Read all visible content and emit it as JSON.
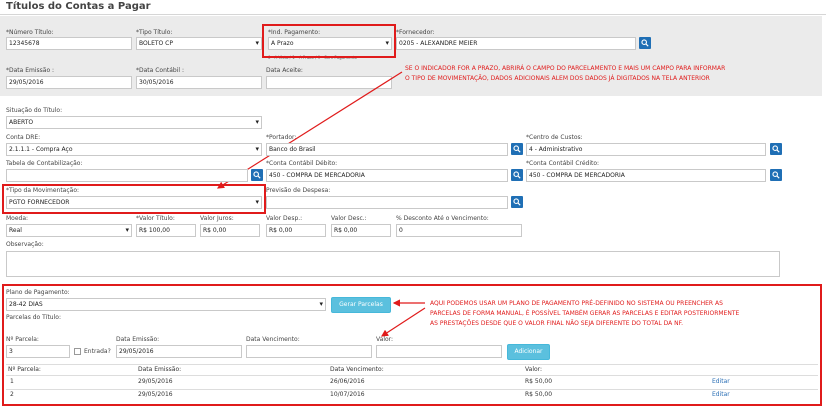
{
  "page_title": "Títulos do Contas a Pagar",
  "header": {
    "numero_titulo": {
      "label": "*Número Título:",
      "value": "12345678"
    },
    "tipo_titulo": {
      "label": "*Tipo Título:",
      "value": "BOLETO CP"
    },
    "ind_pagamento": {
      "label": "*Ind. Pagamento:",
      "value": "A Prazo",
      "hint": "0 - A Vista / 1 - A Prazo / 9 - Sem Pagamento"
    },
    "fornecedor": {
      "label": "*Fornecedor:",
      "value": "0205 - ALEXANDRE MEIER"
    },
    "data_emissao": {
      "label": "*Data Emissão :",
      "value": "29/05/2016"
    },
    "data_contabil": {
      "label": "*Data Contábil :",
      "value": "30/05/2016"
    },
    "data_aceite": {
      "label": "Data Aceite:",
      "value": ""
    }
  },
  "annotations": {
    "top_line1": "SE O INDICADOR FOR A PRAZO, ABRIRÁ O CAMPO DO PARCELAMENTO E MAIS UM CAMPO PARA INFORMAR",
    "top_line2": "O TIPO DE MOVIMENTAÇÃO, DADOS ADICIONAIS ALEM DOS DADOS JÁ DIGITADOS NA TELA ANTERIOR",
    "bottom_line1": "AQUI PODEMOS USAR UM PLANO DE PAGAMENTO PRÉ-DEFINIDO NO SISTEMA OU PREENCHER AS",
    "bottom_line2": "PARCELAS DE FORMA MANUAL, É POSSÍVEL TAMBÉM GERAR AS PARCELAS E EDITAR POSTERIORMENTE",
    "bottom_line3": "AS PRESTAÇÕES DESDE QUE O VALOR FINAL NÃO SEJA DIFERENTE DO TOTAL DA NF."
  },
  "form": {
    "situacao": {
      "label": "Situação do Título:",
      "value": "ABERTO"
    },
    "conta_dre": {
      "label": "Conta DRE:",
      "value": "2.1.1.1 - Compra Aço"
    },
    "portador": {
      "label": "*Portador:",
      "value": "Banco do Brasil"
    },
    "centro_custos": {
      "label": "*Centro de Custos:",
      "value": "4 - Administrativo"
    },
    "tabela_contab": {
      "label": "Tabela de Contabilização:",
      "value": ""
    },
    "conta_debito": {
      "label": "*Conta Contábil Débito:",
      "value": "450 - COMPRA DE MERCADORIA"
    },
    "conta_credito": {
      "label": "*Conta Contábil Crédito:",
      "value": "450 - COMPRA DE MERCADORIA"
    },
    "tipo_movimentacao": {
      "label": "*Tipo da Movimentação:",
      "value": "PGTO FORNECEDOR"
    },
    "previsao_despesa": {
      "label": "Previsão de Despesa:",
      "value": ""
    },
    "moeda": {
      "label": "Moeda:",
      "value": "Real"
    },
    "valor_titulo": {
      "label": "*Valor Título:",
      "value": "R$ 100,00"
    },
    "valor_juros": {
      "label": "Valor Juros:",
      "value": "R$ 0,00"
    },
    "valor_desp": {
      "label": "Valor Desp.:",
      "value": "R$ 0,00"
    },
    "valor_desc": {
      "label": "Valor Desc.:",
      "value": "R$ 0,00"
    },
    "pct_desconto": {
      "label": "% Desconto Até o Vencimento:",
      "value": "0"
    },
    "observacao": {
      "label": "Observação:",
      "value": ""
    }
  },
  "payment": {
    "plano_label": "Plano de Pagamento:",
    "plano_value": "28-42 DIAS",
    "gerar_button": "Gerar Parcelas",
    "parcelas_label": "Parcelas do Título:",
    "entry": {
      "n_parcela_label": "Nº Parcela:",
      "n_parcela_value": "3",
      "entrada_label": "Entrada?",
      "data_emissao_label": "Data Emissão:",
      "data_emissao_value": "29/05/2016",
      "data_venc_label": "Data Vencimento:",
      "data_venc_value": "",
      "valor_label": "Valor:",
      "valor_value": "",
      "adicionar_button": "Adicionar"
    },
    "table": {
      "headers": [
        "Nº Parcela:",
        "Data Emissão:",
        "Data Vencimento:",
        "Valor:"
      ],
      "rows": [
        {
          "n": "1",
          "emissao": "29/05/2016",
          "vencimento": "26/06/2016",
          "valor": "R$ 50,00",
          "action": "Editar"
        },
        {
          "n": "2",
          "emissao": "29/05/2016",
          "vencimento": "10/07/2016",
          "valor": "R$ 50,00",
          "action": "Editar"
        }
      ]
    }
  },
  "colors": {
    "accent": "#1f6fb5",
    "annotation": "#e01b1b",
    "button": "#5bc0de",
    "panel": "#ebebeb"
  },
  "icons": [
    "search-icon",
    "chevron-down-icon",
    "arrow-icon"
  ]
}
